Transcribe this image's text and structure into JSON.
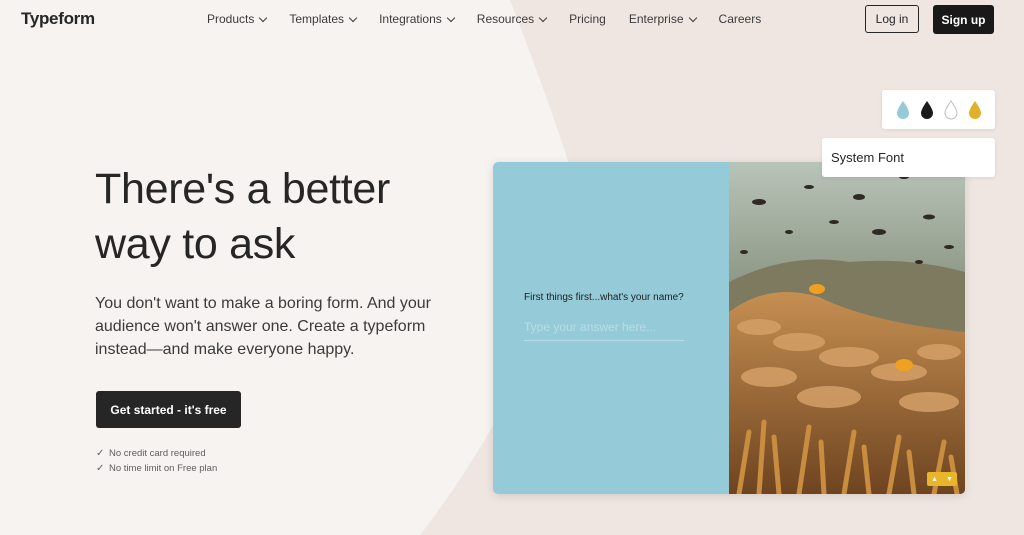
{
  "nav": {
    "logo": "Typeform",
    "items": [
      {
        "label": "Products",
        "dropdown": true
      },
      {
        "label": "Templates",
        "dropdown": true
      },
      {
        "label": "Integrations",
        "dropdown": true
      },
      {
        "label": "Resources",
        "dropdown": true
      },
      {
        "label": "Pricing",
        "dropdown": false
      },
      {
        "label": "Enterprise",
        "dropdown": true
      },
      {
        "label": "Careers",
        "dropdown": false
      }
    ],
    "login_label": "Log in",
    "signup_label": "Sign up"
  },
  "hero": {
    "title": "There's a better way to ask",
    "subtitle": "You don't want to make a boring form. And your audience won't answer one. Create a typeform instead—and make everyone happy.",
    "cta_label": "Get started - it's free",
    "checks": [
      "No credit card required",
      "No time limit on Free plan"
    ],
    "check_icon": "✓"
  },
  "preview": {
    "question": "First things first...what's your name?",
    "answer_placeholder": "Type your answer here...",
    "left_color": "#95cbd8",
    "nav_up": "▲",
    "nav_down": "▼",
    "accent_color": "#e8b52b"
  },
  "palette": {
    "drops": [
      {
        "name": "teal-drop-icon",
        "color": "#95cbd8",
        "outlined": false
      },
      {
        "name": "black-drop-icon",
        "color": "#1b1b1b",
        "outlined": false
      },
      {
        "name": "white-drop-icon",
        "color": "#ffffff",
        "outlined": true
      },
      {
        "name": "yellow-drop-icon",
        "color": "#e2b12c",
        "outlined": false
      }
    ]
  },
  "font_selector": {
    "label": "System Font"
  }
}
